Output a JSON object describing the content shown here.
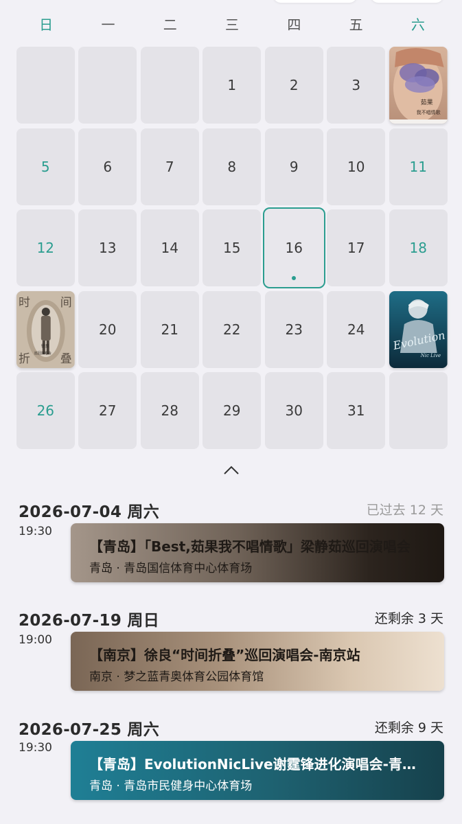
{
  "weekdays": [
    "日",
    "一",
    "二",
    "三",
    "四",
    "五",
    "六"
  ],
  "calendar": {
    "row1": [
      "",
      "",
      "",
      "1",
      "2",
      "3",
      ""
    ],
    "row2": [
      "5",
      "6",
      "7",
      "8",
      "9",
      "10",
      "11"
    ],
    "row3": [
      "12",
      "13",
      "14",
      "15",
      "16",
      "17",
      "18"
    ],
    "row4": [
      "",
      "20",
      "21",
      "22",
      "23",
      "24",
      ""
    ],
    "row5": [
      "26",
      "27",
      "28",
      "29",
      "30",
      "31",
      ""
    ]
  },
  "posters": {
    "p4": {
      "line1": "茹果",
      "line2": "我不唱情歌"
    },
    "p19": {
      "top_left": "时",
      "top_right": "间",
      "bottom_left": "折",
      "bottom_right": "叠",
      "center": "徐良",
      "sub": "巡回演唱会"
    },
    "p25": {
      "script": "Evolution",
      "sub": "Nic Live"
    }
  },
  "events": [
    {
      "date": "2026-07-04 周六",
      "status": "已过去 12 天",
      "time": "19:30",
      "title": "【青岛】「Best,茹果我不唱情歌」梁静茹巡回演唱会",
      "venue": "青岛 · 青岛国信体育中心体育场"
    },
    {
      "date": "2026-07-19 周日",
      "status": "还剩余 3 天",
      "time": "19:00",
      "title": "【南京】徐良“时间折叠”巡回演唱会-南京站",
      "venue": "南京 · 梦之蓝青奥体育公园体育馆"
    },
    {
      "date": "2026-07-25 周六",
      "status": "还剩余 9 天",
      "time": "19:30",
      "title": "【青岛】EvolutionNicLive谢霆锋进化演唱会-青岛站",
      "venue": "青岛 · 青岛市民健身中心体育场"
    }
  ],
  "colors": {
    "accent": "#2a9d8f",
    "cell_bg": "#e4e3e8",
    "page_bg": "#f2f1f6"
  },
  "icons": {
    "collapse": "chevron-up-icon"
  }
}
